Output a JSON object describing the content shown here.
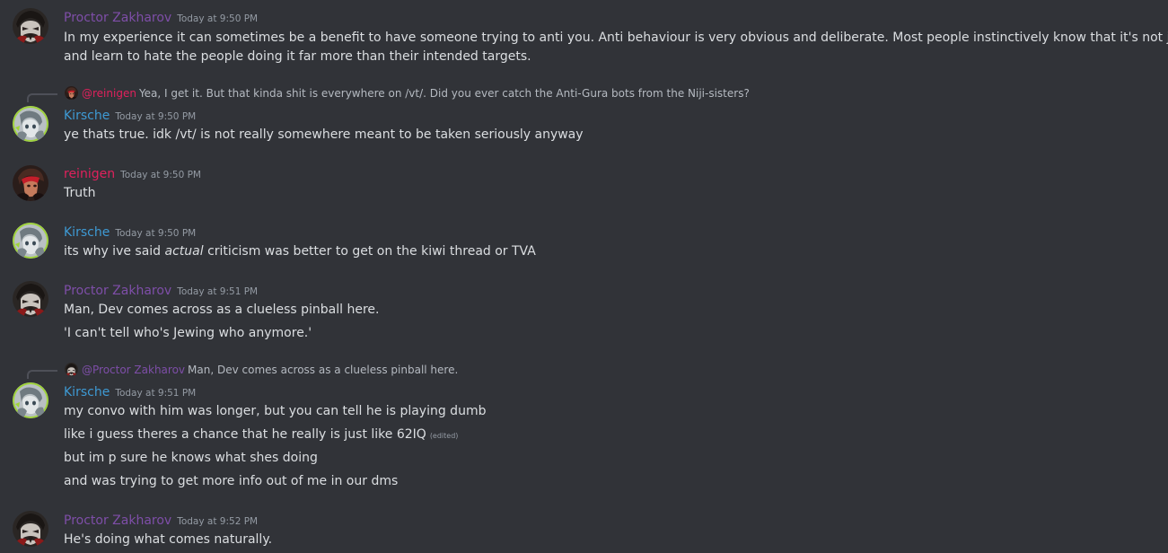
{
  "colors": {
    "background": "#313338",
    "proctor": "#7e4ea8",
    "kirsche": "#3e9ad4",
    "reinigen": "#e0215c",
    "text": "#dbdee1",
    "muted": "#949ba4"
  },
  "messages": [
    {
      "author": "Proctor Zakharov",
      "timestamp": "Today at 9:50 PM",
      "avatar_icon": "proctor-avatar-icon",
      "lines": [
        "In my experience it can sometimes be a benefit to have someone trying to anti you. Anti behaviour is very obvious and deliberate. Most people instinctively know that it's not justified",
        "and learn to hate the people doing it far more than their intended targets."
      ]
    },
    {
      "reply": {
        "mention": "@reinigen",
        "text": "Yea, I get it. But that kinda shit is everywhere on /vt/. Did you ever catch the Anti-Gura bots from the Niji-sisters?"
      },
      "author": "Kirsche",
      "timestamp": "Today at 9:50 PM",
      "avatar_icon": "kirsche-avatar-icon",
      "lines": [
        "ye thats true. idk /vt/ is not really somewhere meant to be taken seriously anyway"
      ]
    },
    {
      "author": "reinigen",
      "timestamp": "Today at 9:50 PM",
      "avatar_icon": "reinigen-avatar-icon",
      "lines": [
        "Truth"
      ]
    },
    {
      "author": "Kirsche",
      "timestamp": "Today at 9:50 PM",
      "avatar_icon": "kirsche-avatar-icon",
      "lines_rich": {
        "before": "its why ive said ",
        "emphasis": "actual",
        "after": " criticism was better to get on the kiwi thread or TVA"
      }
    },
    {
      "author": "Proctor Zakharov",
      "timestamp": "Today at 9:51 PM",
      "avatar_icon": "proctor-avatar-icon",
      "lines": [
        "Man, Dev comes across as a clueless pinball here.",
        "'I can't tell who's Jewing who anymore.'"
      ]
    },
    {
      "reply": {
        "mention": "@Proctor Zakharov",
        "text": "Man, Dev comes across as a clueless pinball here."
      },
      "author": "Kirsche",
      "timestamp": "Today at 9:51 PM",
      "avatar_icon": "kirsche-avatar-icon",
      "lines": [
        "my convo with him was longer, but you can tell he is playing dumb",
        "like i guess theres a chance that he really is just like 62IQ",
        "but im p sure he knows what shes doing",
        "and was trying to get more info out of me in our dms"
      ],
      "edited_label": "(edited)"
    },
    {
      "author": "Proctor Zakharov",
      "timestamp": "Today at 9:52 PM",
      "avatar_icon": "proctor-avatar-icon",
      "lines": [
        "He's doing what comes naturally."
      ]
    }
  ]
}
